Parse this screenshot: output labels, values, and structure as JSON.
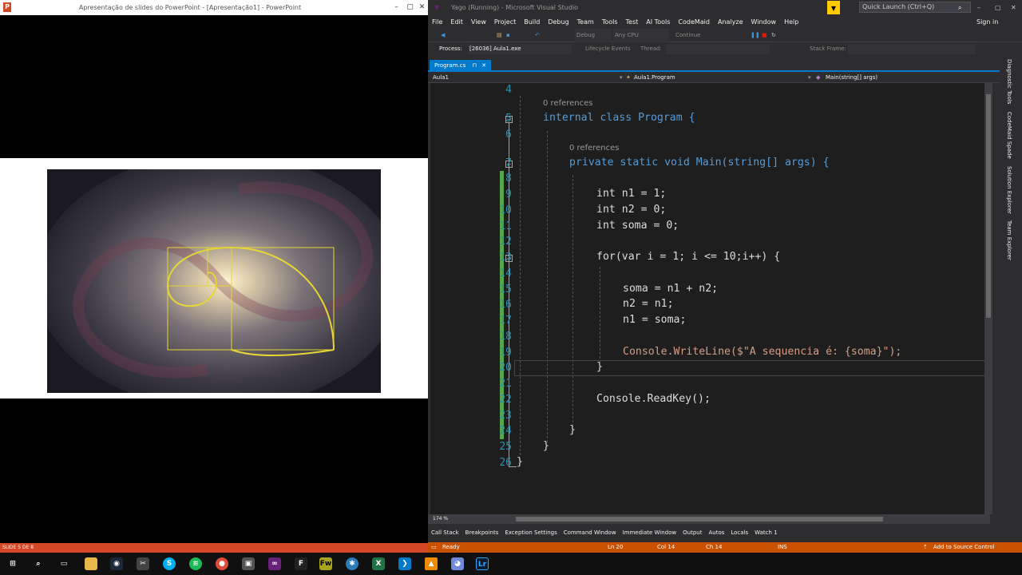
{
  "powerpoint": {
    "title": "Apresentação de slides do PowerPoint - [Apresentação1] - PowerPoint",
    "slide_status": "SLIDE 5 DE 8"
  },
  "vs": {
    "title": "Yago (Running) - Microsoft Visual Studio",
    "quick_launch": "Quick Launch (Ctrl+Q)",
    "menu": [
      "File",
      "Edit",
      "View",
      "Project",
      "Build",
      "Debug",
      "Team",
      "Tools",
      "Test",
      "AI Tools",
      "CodeMaid",
      "Analyze",
      "Window",
      "Help"
    ],
    "sign_in": "Sign in",
    "toolbar": {
      "config": "Debug",
      "platform": "Any CPU",
      "continue": "Continue"
    },
    "process_label": "Process:",
    "process_value": "[26036] Aula1.exe",
    "lifecycle": "Lifecycle Events",
    "thread": "Thread:",
    "stack_frame": "Stack Frame:",
    "tab": "Program.cs",
    "nav": {
      "project": "Aula1",
      "class": "Aula1.Program",
      "member": "Main(string[] args)"
    },
    "zoom": "174 %",
    "right_tabs": [
      "Diagnostic Tools",
      "CodeMaid Spade",
      "Solution Explorer",
      "Team Explorer"
    ],
    "bottom_tabs": [
      "Call Stack",
      "Breakpoints",
      "Exception Settings",
      "Command Window",
      "Immediate Window",
      "Output",
      "Autos",
      "Locals",
      "Watch 1"
    ],
    "status": {
      "ready": "Ready",
      "ln": "Ln 20",
      "col": "Col 14",
      "ch": "Ch 14",
      "ins": "INS",
      "source": "Add to Source Control"
    }
  },
  "code": {
    "references": "0 references",
    "lines": [
      {
        "n": "4",
        "t": ""
      },
      {
        "n": "5",
        "t": "internal class Program {"
      },
      {
        "n": "6",
        "t": ""
      },
      {
        "n": "7",
        "t": "private static void Main(string[] args) {"
      },
      {
        "n": "8",
        "t": ""
      },
      {
        "n": "9",
        "t": "int n1 = 1;"
      },
      {
        "n": "10",
        "t": "int n2 = 0;"
      },
      {
        "n": "11",
        "t": "int soma = 0;"
      },
      {
        "n": "12",
        "t": ""
      },
      {
        "n": "13",
        "t": "for(var i = 1; i <= 10;i++) {"
      },
      {
        "n": "14",
        "t": ""
      },
      {
        "n": "15",
        "t": "soma = n1 + n2;"
      },
      {
        "n": "16",
        "t": "n2 = n1;"
      },
      {
        "n": "17",
        "t": "n1 = soma;"
      },
      {
        "n": "18",
        "t": ""
      },
      {
        "n": "19",
        "t": "Console.WriteLine($\"A sequencia é: {soma}\");"
      },
      {
        "n": "20",
        "t": "}"
      },
      {
        "n": "21",
        "t": ""
      },
      {
        "n": "22",
        "t": "Console.ReadKey();"
      },
      {
        "n": "23",
        "t": ""
      },
      {
        "n": "24",
        "t": "}"
      },
      {
        "n": "25",
        "t": "}"
      },
      {
        "n": "26",
        "t": "}"
      }
    ]
  },
  "taskbar": {
    "icons": [
      "windows-start-icon",
      "search-icon",
      "task-view-icon",
      "file-explorer-icon",
      "steam-icon",
      "snipping-icon",
      "skype-icon",
      "spotify-icon",
      "chrome-icon",
      "photos-icon",
      "visual-studio-icon",
      "fl-studio-icon",
      "fireworks-icon",
      "network-icon",
      "excel-icon",
      "vs-code-icon",
      "vlc-icon",
      "discord-icon",
      "lightroom-icon"
    ]
  }
}
